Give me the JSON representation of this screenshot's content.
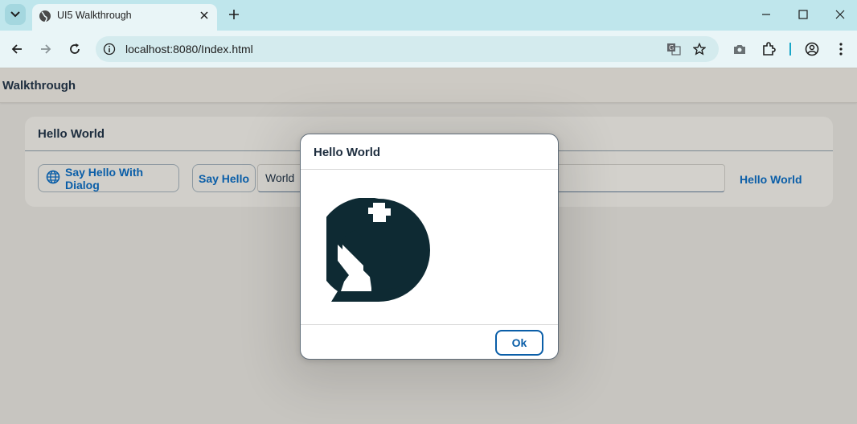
{
  "browser": {
    "tab": {
      "title": "UI5 Walkthrough"
    },
    "url": "localhost:8080/Index.html",
    "icons": [
      "tab-list-icon",
      "favicon-globe-icon",
      "close-icon",
      "plus-icon",
      "minimize-icon",
      "maximize-icon",
      "window-close-icon",
      "back-icon",
      "forward-icon",
      "reload-icon",
      "site-info-icon",
      "translate-icon",
      "star-icon",
      "camera-icon",
      "extensions-icon",
      "profile-icon",
      "more-icon"
    ],
    "separator_color": "#1aa7c8"
  },
  "shell": {
    "title": "Walkthrough"
  },
  "panel": {
    "title": "Hello World",
    "say_hello_dialog_label": "Say Hello With Dialog",
    "say_hello_label": "Say Hello",
    "input_value": "World",
    "result_text": "Hello World"
  },
  "dialog": {
    "title": "Hello World",
    "icon": "world-icon",
    "ok_label": "Ok"
  },
  "colors": {
    "accent": "#0a5ea8",
    "text": "#1d2d3e",
    "page_background": "#c7c5c0",
    "tabbar": "#bfe6ec"
  }
}
